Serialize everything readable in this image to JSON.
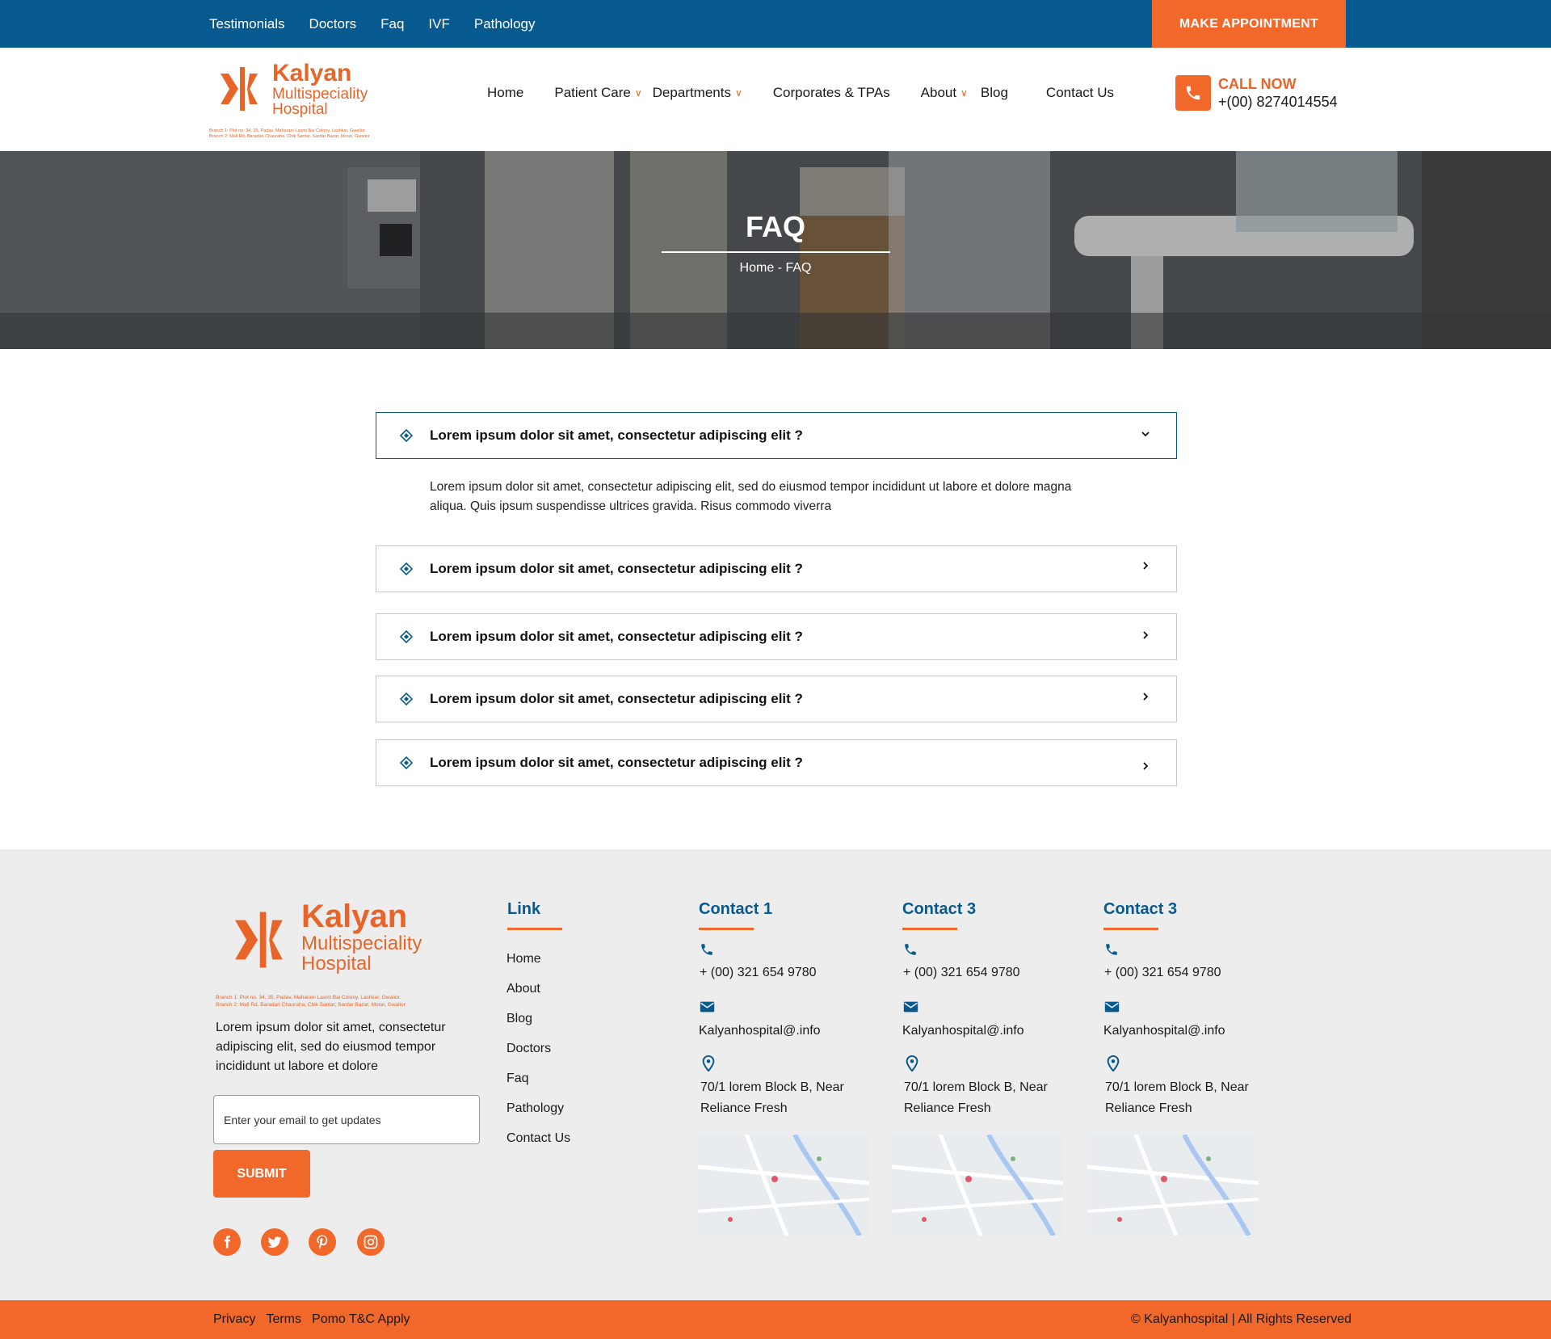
{
  "topbar": {
    "links": [
      "Testimonials",
      "Doctors",
      "Faq",
      "IVF",
      "Pathology"
    ],
    "appointment_label": "MAKE APPOINTMENT"
  },
  "header": {
    "logo": {
      "name_line1": "Kalyan",
      "name_line2": "Multispeciality",
      "name_line3": "Hospital",
      "branch1": "Branch 1: Plot no. 34, 35, Padav, Maharani Laxmi Bai Colony, Lashkar, Gwalior.",
      "branch2": "Branch 2: Mall Rd, Baradari Chauraha, Chik Santar, Sardar Bazar, Morar, Gwalior"
    },
    "nav": [
      {
        "label": "Home",
        "dropdown": false
      },
      {
        "label": "Patient Care",
        "dropdown": true
      },
      {
        "label": "Departments",
        "dropdown": true
      },
      {
        "label": "Corporates & TPAs",
        "dropdown": false
      },
      {
        "label": "About",
        "dropdown": true
      },
      {
        "label": "Blog",
        "dropdown": false
      },
      {
        "label": "Contact Us",
        "dropdown": false
      }
    ],
    "call_label": "CALL NOW",
    "call_number": "+(00) 8274014554"
  },
  "hero": {
    "title": "FAQ",
    "breadcrumb": "Home - FAQ"
  },
  "faq": {
    "items": [
      {
        "question": "Lorem ipsum dolor sit amet, consectetur adipiscing elit ?",
        "expanded": true
      },
      {
        "question": "Lorem ipsum dolor sit amet, consectetur adipiscing elit ?",
        "expanded": false
      },
      {
        "question": "Lorem ipsum dolor sit amet, consectetur adipiscing elit ?",
        "expanded": false
      },
      {
        "question": "Lorem ipsum dolor sit amet, consectetur adipiscing elit ?",
        "expanded": false
      },
      {
        "question": "Lorem ipsum dolor sit amet, consectetur adipiscing elit ?",
        "expanded": false
      }
    ],
    "answer": "Lorem ipsum dolor sit amet, consectetur adipiscing elit, sed do eiusmod tempor incididunt ut labore et dolore magna aliqua. Quis ipsum suspendisse ultrices gravida. Risus commodo viverra"
  },
  "footer": {
    "description": "Lorem ipsum dolor sit amet, consectetur adipiscing elit, sed do eiusmod tempor incididunt ut labore et dolore",
    "email_placeholder": "Enter your email to get updates",
    "submit_label": "SUBMIT",
    "social": [
      "facebook-icon",
      "twitter-icon",
      "pinterest-icon",
      "instagram-icon"
    ],
    "link_heading": "Link",
    "links": [
      "Home",
      "About",
      "Blog",
      "Doctors",
      "Faq",
      "Pathology",
      "Contact Us"
    ],
    "contacts": [
      {
        "heading": "Contact 1",
        "phone": "+ (00) 321 654 9780",
        "email": "Kalyanhospital@.info",
        "address_line1": "70/1 lorem Block B, Near",
        "address_line2": "Reliance Fresh"
      },
      {
        "heading": "Contact 3",
        "phone": "+ (00) 321 654 9780",
        "email": "Kalyanhospital@.info",
        "address_line1": "70/1 lorem Block B, Near",
        "address_line2": "Reliance Fresh"
      },
      {
        "heading": "Contact 3",
        "phone": "+ (00) 321 654 9780",
        "email": "Kalyanhospital@.info",
        "address_line1": "70/1 lorem Block B, Near",
        "address_line2": "Reliance Fresh"
      }
    ],
    "bottom_links": [
      "Privacy",
      "Terms",
      "Pomo T&C Apply"
    ],
    "copyright": "© Kalyanhospital | All Rights Reserved"
  },
  "colors": {
    "primary_blue": "#075a8f",
    "accent_orange": "#f2672a",
    "footer_bg": "#ededed"
  }
}
